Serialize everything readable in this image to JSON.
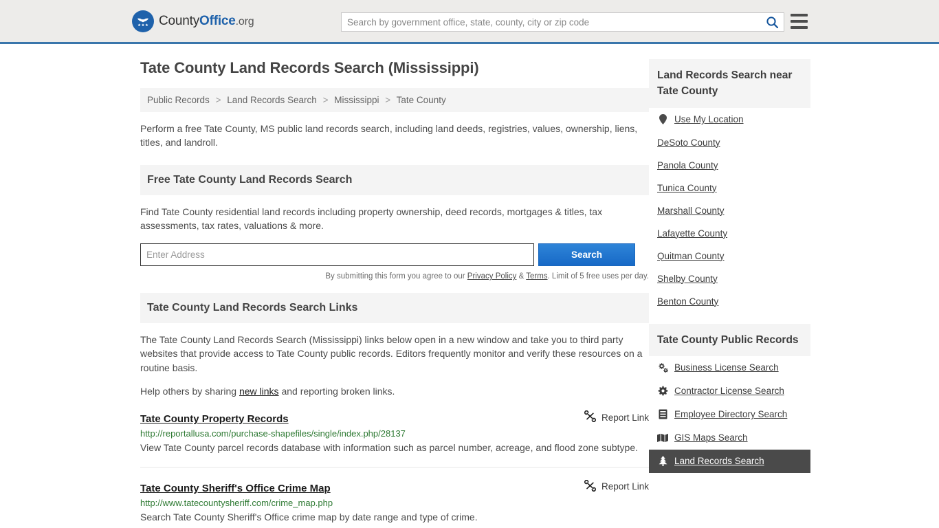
{
  "header": {
    "logo": {
      "icon": "eagle-shield-logo-icon",
      "text_part1": "County",
      "text_part2": "Office",
      "text_part3": ".org"
    },
    "search": {
      "placeholder": "Search by government office, state, county, city or zip code",
      "value": "",
      "button_icon": "search-icon"
    },
    "menu_icon": "hamburger-menu-icon",
    "accent_color": "#3a76ab"
  },
  "main": {
    "title": "Tate County Land Records Search (Mississippi)",
    "breadcrumb": [
      "Public Records",
      "Land Records Search",
      "Mississippi",
      "Tate County"
    ],
    "breadcrumb_separator": ">",
    "intro": "Perform a free Tate County, MS public land records search, including land deeds, registries, values, ownership, liens, titles, and landroll.",
    "search_section": {
      "heading": "Free Tate County Land Records Search",
      "description": "Find Tate County residential land records including property ownership, deed records, mortgages & titles, tax assessments, tax rates, valuations & more.",
      "input_placeholder": "Enter Address",
      "input_value": "",
      "button_label": "Search",
      "button_color": "#2174d1",
      "disclaimer_prefix": "By submitting this form you agree to our ",
      "disclaimer_privacy": "Privacy Policy",
      "disclaimer_amp": " & ",
      "disclaimer_terms": "Terms",
      "disclaimer_suffix": ". Limit of 5 free uses per day."
    },
    "links_section": {
      "heading": "Tate County Land Records Search Links",
      "description": "The Tate County Land Records Search (Mississippi) links below open in a new window and take you to third party websites that provide access to Tate County public records. Editors frequently monitor and verify these resources on a routine basis.",
      "share_prefix": "Help others by sharing ",
      "share_link": "new links",
      "share_suffix": " and reporting broken links.",
      "report_label": "Report Link",
      "report_icon": "broken-link-icon",
      "entries": [
        {
          "title": "Tate County Property Records",
          "url": "http://reportallusa.com/purchase-shapefiles/single/index.php/28137",
          "description": "View Tate County parcel records database with information such as parcel number, acreage, and flood zone subtype.",
          "url_color": "#2e7a33"
        },
        {
          "title": "Tate County Sheriff's Office Crime Map",
          "url": "http://www.tatecountysheriff.com/crime_map.php",
          "description": "Search Tate County Sheriff's Office crime map by date range and type of crime.",
          "url_color": "#2e7a33"
        }
      ]
    }
  },
  "sidebar": {
    "nearby": {
      "heading": "Land Records Search near Tate County",
      "items": [
        {
          "label": "Use My Location",
          "icon": "map-pin-icon",
          "active": false
        },
        {
          "label": "DeSoto County",
          "icon": "",
          "active": false
        },
        {
          "label": "Panola County",
          "icon": "",
          "active": false
        },
        {
          "label": "Tunica County",
          "icon": "",
          "active": false
        },
        {
          "label": "Marshall County",
          "icon": "",
          "active": false
        },
        {
          "label": "Lafayette County",
          "icon": "",
          "active": false
        },
        {
          "label": "Quitman County",
          "icon": "",
          "active": false
        },
        {
          "label": "Shelby County",
          "icon": "",
          "active": false
        },
        {
          "label": "Benton County",
          "icon": "",
          "active": false
        }
      ]
    },
    "public_records": {
      "heading": "Tate County Public Records",
      "items": [
        {
          "label": "Business License Search",
          "icon": "gears-icon",
          "active": false
        },
        {
          "label": "Contractor License Search",
          "icon": "gear-icon",
          "active": false
        },
        {
          "label": "Employee Directory Search",
          "icon": "list-card-icon",
          "active": false
        },
        {
          "label": "GIS Maps Search",
          "icon": "folded-map-icon",
          "active": false
        },
        {
          "label": "Land Records Search",
          "icon": "tree-icon",
          "active": true
        }
      ],
      "active_bg": "#4a4a4a"
    }
  }
}
